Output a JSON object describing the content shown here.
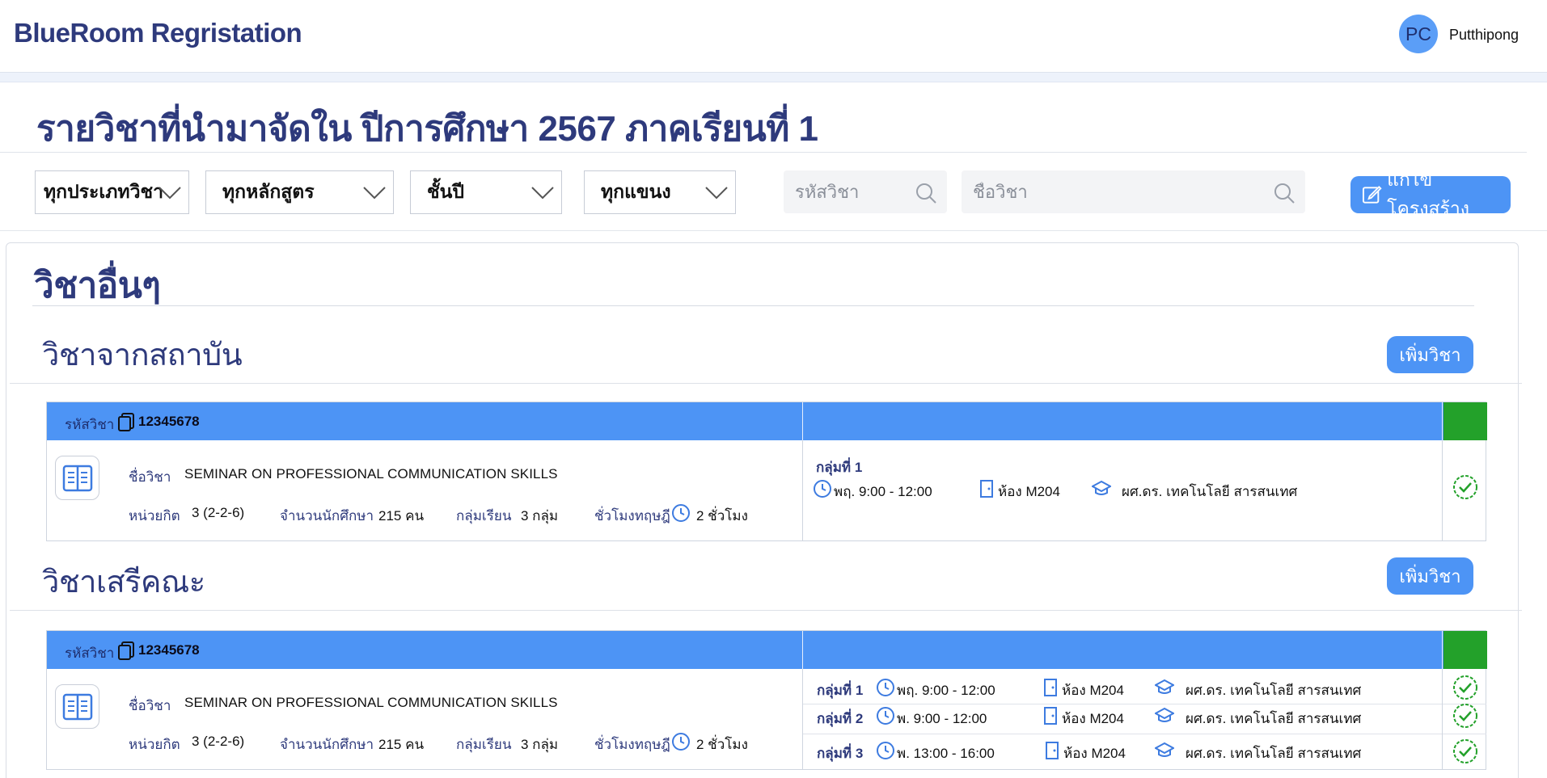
{
  "app": {
    "brand": "BlueRoom Regristation",
    "user_initials": "PC",
    "user_name": "Putthipong"
  },
  "page": {
    "title": "รายวิชาที่นำมาจัดใน ปีการศึกษา 2567 ภาคเรียนที่ 1"
  },
  "filters": {
    "category": "ทุกประเภทวิชา",
    "curriculum": "ทุกหลักสูตร",
    "year": "ชั้นปี",
    "major": "ทุกแขนง",
    "code_placeholder": "รหัสวิชา",
    "name_placeholder": "ชื่อวิชา",
    "edit_button": "แก้ไขโครงสร้าง"
  },
  "colors": {
    "primary": "#4d94f5",
    "brand_text": "#2e3a7c",
    "approved": "#23a12a"
  },
  "icons": {
    "search": "search-icon",
    "edit": "edit-icon",
    "book": "book-icon",
    "clock": "clock-icon",
    "door": "door-icon",
    "teacher": "graduation-cap-icon",
    "check": "check-circle-icon",
    "copy": "copy-icon",
    "chevron": "chevron-down-icon"
  },
  "section": {
    "title": "วิชาอื่นๆ",
    "groups": [
      {
        "title": "วิชาจากสถาบัน",
        "add_label": "เพิ่มวิชา",
        "course": {
          "code_label": "รหัสวิชา",
          "code": "12345678",
          "name_label": "ชื่อวิชา",
          "name": "SEMINAR ON PROFESSIONAL COMMUNICATION SKILLS",
          "credit_label": "หน่วยกิต",
          "credit": "3 (2-2-6)",
          "students_label": "จำนวนนักศึกษา",
          "students": "215 คน",
          "sections_label": "กลุ่มเรียน",
          "sections": "3 กลุ่ม",
          "hours_label": "ชั่วโมงทฤษฎี",
          "hours": "2 ชั่วโมง",
          "groups": [
            {
              "name": "กลุ่มที่ 1",
              "time": "พฤ. 9:00 - 12:00",
              "room": "ห้อง M204",
              "teacher": "ผศ.ดร. เทคโนโลยี สารสนเทศ"
            }
          ]
        }
      },
      {
        "title": "วิชาเสรีคณะ",
        "add_label": "เพิ่มวิชา",
        "course": {
          "code_label": "รหัสวิชา",
          "code": "12345678",
          "name_label": "ชื่อวิชา",
          "name": "SEMINAR ON PROFESSIONAL COMMUNICATION SKILLS",
          "credit_label": "หน่วยกิต",
          "credit": "3 (2-2-6)",
          "students_label": "จำนวนนักศึกษา",
          "students": "215 คน",
          "sections_label": "กลุ่มเรียน",
          "sections": "3 กลุ่ม",
          "hours_label": "ชั่วโมงทฤษฎี",
          "hours": "2 ชั่วโมง",
          "groups": [
            {
              "name": "กลุ่มที่ 1",
              "time": "พฤ. 9:00 - 12:00",
              "room": "ห้อง M204",
              "teacher": "ผศ.ดร. เทคโนโลยี สารสนเทศ"
            },
            {
              "name": "กลุ่มที่ 2",
              "time": "พ. 9:00 - 12:00",
              "room": "ห้อง M204",
              "teacher": "ผศ.ดร. เทคโนโลยี สารสนเทศ"
            },
            {
              "name": "กลุ่มที่ 3",
              "time": "พ. 13:00 - 16:00",
              "room": "ห้อง M204",
              "teacher": "ผศ.ดร. เทคโนโลยี สารสนเทศ"
            }
          ]
        }
      }
    ]
  }
}
